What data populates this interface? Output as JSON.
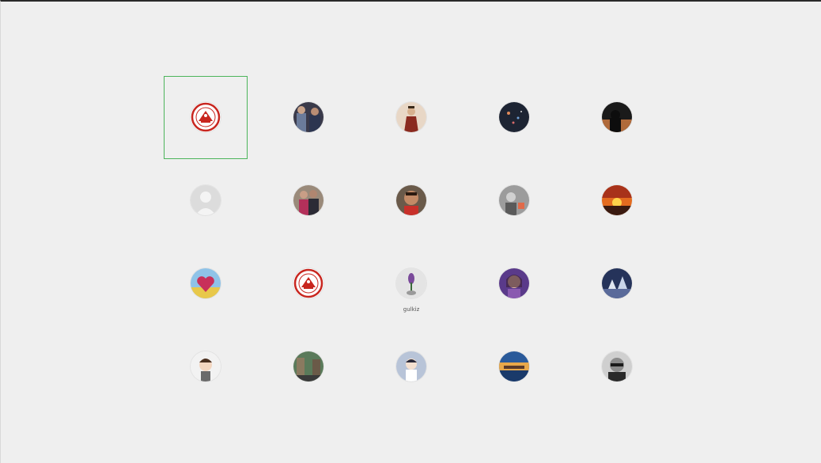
{
  "accounts": [
    {
      "name": "",
      "avatar": "university-seal-icon",
      "selected": true
    },
    {
      "name": "",
      "avatar": "group-photo-icon"
    },
    {
      "name": "",
      "avatar": "traditional-costume-photo-icon"
    },
    {
      "name": "",
      "avatar": "night-lights-photo-icon"
    },
    {
      "name": "",
      "avatar": "silhouette-photo-icon"
    },
    {
      "name": "",
      "avatar": "default-user-icon"
    },
    {
      "name": "",
      "avatar": "couple-photo-icon"
    },
    {
      "name": "",
      "avatar": "child-photo-icon"
    },
    {
      "name": "",
      "avatar": "grey-portrait-icon"
    },
    {
      "name": "",
      "avatar": "sunset-photo-icon"
    },
    {
      "name": "",
      "avatar": "heart-field-icon"
    },
    {
      "name": "",
      "avatar": "university-seal-icon"
    },
    {
      "name": "gulkiz",
      "avatar": "flower-vase-icon"
    },
    {
      "name": "",
      "avatar": "girl-portrait-icon"
    },
    {
      "name": "",
      "avatar": "blue-night-scene-icon"
    },
    {
      "name": "",
      "avatar": "cartoon-girl-icon"
    },
    {
      "name": "",
      "avatar": "city-street-icon"
    },
    {
      "name": "",
      "avatar": "illustration-girl-icon"
    },
    {
      "name": "",
      "avatar": "lake-scene-icon"
    },
    {
      "name": "",
      "avatar": "man-sunglasses-icon"
    }
  ],
  "colors": {
    "selection_border": "#4cb45b",
    "background": "#efefef"
  }
}
